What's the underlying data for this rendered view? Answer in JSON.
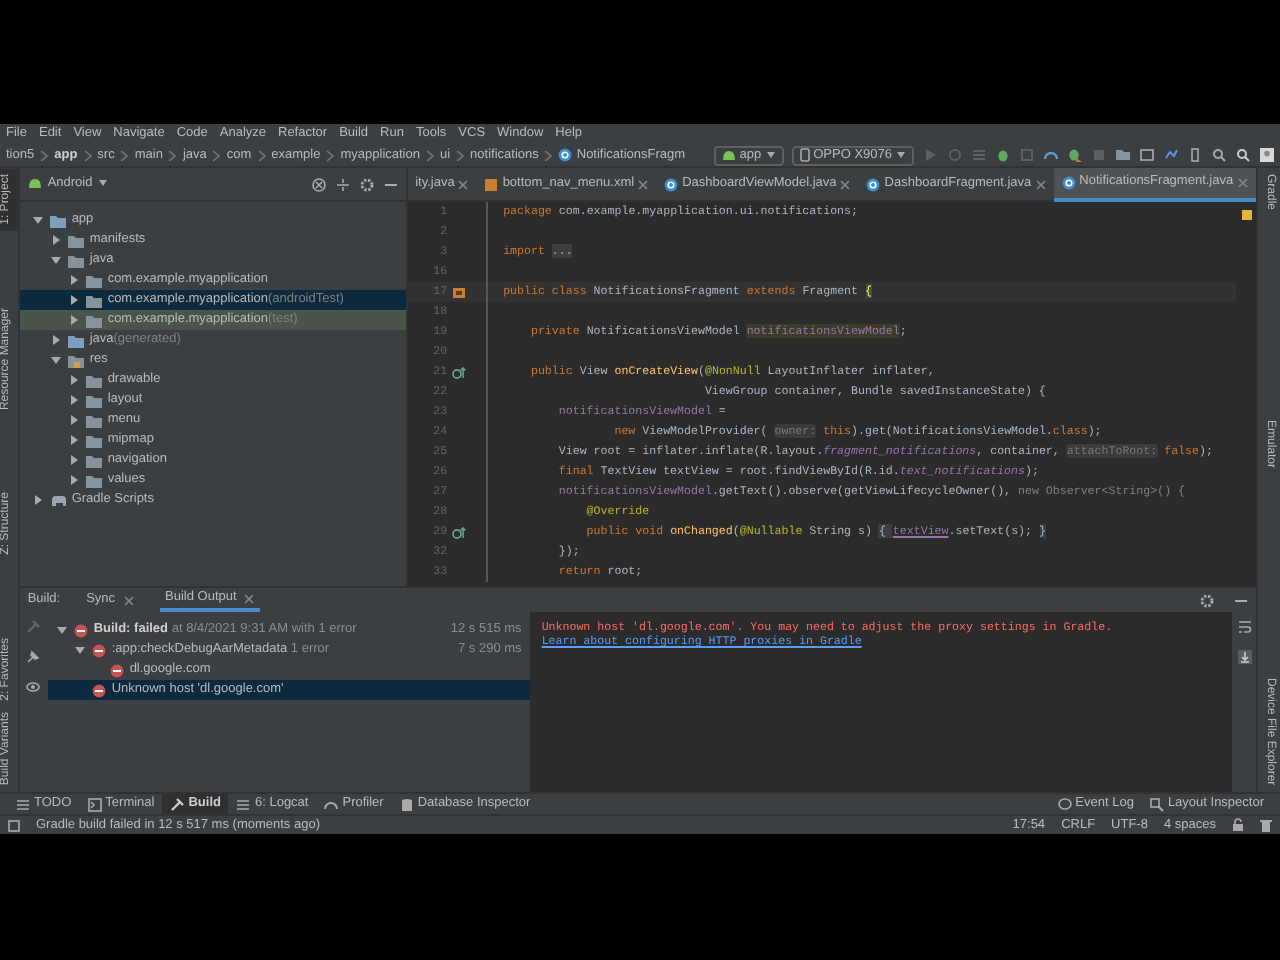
{
  "menu_bar": [
    "File",
    "Edit",
    "View",
    "Navigate",
    "Code",
    "Analyze",
    "Refactor",
    "Build",
    "Run",
    "Tools",
    "VCS",
    "Window",
    "Help"
  ],
  "breadcrumb": [
    "tion5",
    "app",
    "src",
    "main",
    "java",
    "com",
    "example",
    "myapplication",
    "ui",
    "notifications",
    "NotificationsFragm"
  ],
  "run_config": {
    "module": "app",
    "device": "OPPO X9076"
  },
  "left_strip": [
    {
      "label": "1: Project",
      "selected": true
    },
    {
      "label": "Resource Manager",
      "selected": false
    },
    {
      "label": "Z: Structure",
      "selected": false
    },
    {
      "label": "2: Favorites",
      "selected": false
    },
    {
      "label": "Build Variants",
      "selected": false
    }
  ],
  "project_panel": {
    "view": "Android",
    "tree": [
      {
        "label": "app",
        "kind": "module",
        "expanded": true,
        "selected": false,
        "children": [
          {
            "label": "manifests",
            "kind": "folder",
            "expanded": false,
            "selected": false
          },
          {
            "label": "java",
            "kind": "folder",
            "expanded": true,
            "selected": false,
            "children": [
              {
                "label": "com.example.myapplication",
                "kind": "package",
                "expanded": false,
                "selected": false
              },
              {
                "label": "com.example.myapplication",
                "suffix": "(androidTest)",
                "kind": "package-test",
                "expanded": false,
                "selected": true
              },
              {
                "label": "com.example.myapplication",
                "suffix": "(test)",
                "kind": "package-test",
                "expanded": false,
                "selected": false
              }
            ]
          },
          {
            "label": "java",
            "suffix": "(generated)",
            "kind": "generated",
            "expanded": false,
            "selected": false
          },
          {
            "label": "res",
            "kind": "res",
            "expanded": true,
            "selected": false,
            "children": [
              {
                "label": "drawable",
                "kind": "package",
                "expanded": false,
                "selected": false
              },
              {
                "label": "layout",
                "kind": "package",
                "expanded": false,
                "selected": false
              },
              {
                "label": "menu",
                "kind": "package",
                "expanded": false,
                "selected": false
              },
              {
                "label": "mipmap",
                "kind": "package",
                "expanded": false,
                "selected": false
              },
              {
                "label": "navigation",
                "kind": "package",
                "expanded": false,
                "selected": false
              },
              {
                "label": "values",
                "kind": "package",
                "expanded": false,
                "selected": false
              }
            ]
          }
        ]
      },
      {
        "label": "Gradle Scripts",
        "kind": "gradle",
        "expanded": false,
        "selected": false
      }
    ]
  },
  "editor_tabs": [
    {
      "label": "ity.java",
      "kind": "plain",
      "selected": false
    },
    {
      "label": "bottom_nav_menu.xml",
      "kind": "xml",
      "selected": false
    },
    {
      "label": "DashboardViewModel.java",
      "kind": "class",
      "selected": false
    },
    {
      "label": "DashboardFragment.java",
      "kind": "class",
      "selected": false
    },
    {
      "label": "NotificationsFragment.java",
      "kind": "class",
      "selected": true
    }
  ],
  "code_lines": [
    {
      "number": "1",
      "kind": "plain",
      "tokens": [
        {
          "kind": "kw",
          "text": "package "
        },
        {
          "kind": "text",
          "text": "com.example.myapplication.ui.notifications;"
        }
      ]
    },
    {
      "number": "2",
      "kind": "plain"
    },
    {
      "number": "3",
      "kind": "plain",
      "tokens": [
        {
          "kind": "kw",
          "text": "import "
        },
        {
          "kind": "fold",
          "text": "..."
        }
      ]
    },
    {
      "number": "16",
      "kind": "plain"
    },
    {
      "number": "17",
      "kind": "class-marker",
      "current": true,
      "tokens": [
        {
          "kind": "kw",
          "text": "public class "
        },
        {
          "kind": "text",
          "text": "NotificationsFragment "
        },
        {
          "kind": "kw",
          "text": "extends "
        },
        {
          "kind": "text",
          "text": "Fragment "
        },
        {
          "kind": "brace",
          "text": "{"
        }
      ]
    },
    {
      "number": "18",
      "kind": "plain"
    },
    {
      "number": "19",
      "kind": "plain",
      "tokens": [
        {
          "kind": "kw",
          "text": "    private "
        },
        {
          "kind": "text",
          "text": "NotificationsViewModel "
        },
        {
          "kind": "marked",
          "text": "notificationsViewModel"
        },
        {
          "kind": "text",
          "text": ";"
        }
      ]
    },
    {
      "number": "20",
      "kind": "plain"
    },
    {
      "number": "21",
      "kind": "override-marker",
      "tokens": [
        {
          "kind": "kw",
          "text": "    public "
        },
        {
          "kind": "text",
          "text": "View "
        },
        {
          "kind": "method",
          "text": "onCreateView"
        },
        {
          "kind": "text",
          "text": "("
        },
        {
          "kind": "annot",
          "text": "@NonNull"
        },
        {
          "kind": "text",
          "text": " LayoutInflater inflater,"
        }
      ]
    },
    {
      "number": "22",
      "kind": "plain",
      "tokens": [
        {
          "kind": "text",
          "text": "                             ViewGroup container, Bundle savedInstanceState) {"
        }
      ]
    },
    {
      "number": "23",
      "kind": "plain",
      "tokens": [
        {
          "kind": "field",
          "text": "        notificationsViewModel"
        },
        {
          "kind": "text",
          "text": " ="
        }
      ]
    },
    {
      "number": "24",
      "kind": "plain",
      "tokens": [
        {
          "kind": "kw",
          "text": "                new "
        },
        {
          "kind": "text",
          "text": "ViewModelProvider( "
        },
        {
          "kind": "hint",
          "text": "owner:"
        },
        {
          "kind": "kw",
          "text": " this"
        },
        {
          "kind": "text",
          "text": ").get(NotificationsViewModel."
        },
        {
          "kind": "kw",
          "text": "class"
        },
        {
          "kind": "text",
          "text": ");"
        }
      ]
    },
    {
      "number": "25",
      "kind": "plain",
      "tokens": [
        {
          "kind": "text",
          "text": "        View root = inflater.inflate(R.layout."
        },
        {
          "kind": "fielditalic",
          "text": "fragment_notifications"
        },
        {
          "kind": "text",
          "text": ", container, "
        },
        {
          "kind": "hint",
          "text": "attachToRoot:"
        },
        {
          "kind": "kw",
          "text": " false"
        },
        {
          "kind": "text",
          "text": ");"
        }
      ]
    },
    {
      "number": "26",
      "kind": "plain",
      "tokens": [
        {
          "kind": "kw",
          "text": "        final "
        },
        {
          "kind": "text",
          "text": "TextView textView = root.findViewById(R.id."
        },
        {
          "kind": "fielditalic",
          "text": "text_notifications"
        },
        {
          "kind": "text",
          "text": ");"
        }
      ]
    },
    {
      "number": "27",
      "kind": "plain",
      "tokens": [
        {
          "kind": "field",
          "text": "        notificationsViewModel"
        },
        {
          "kind": "text",
          "text": ".getText().observe(getViewLifecycleOwner(), "
        },
        {
          "kind": "dim",
          "text": "new Observer<String>() {"
        }
      ]
    },
    {
      "number": "28",
      "kind": "plain",
      "tokens": [
        {
          "kind": "annot",
          "text": "            @Override"
        }
      ]
    },
    {
      "number": "29",
      "kind": "override-marker",
      "tokens": [
        {
          "kind": "kw",
          "text": "            public void "
        },
        {
          "kind": "method",
          "text": "onChanged"
        },
        {
          "kind": "text",
          "text": "("
        },
        {
          "kind": "annot",
          "text": "@Nullable"
        },
        {
          "kind": "text",
          "text": " String s) "
        },
        {
          "kind": "fold",
          "text": "{ "
        },
        {
          "kind": "underline",
          "text": "textView"
        },
        {
          "kind": "text",
          "text": ".setText(s); "
        },
        {
          "kind": "fold",
          "text": "}"
        }
      ]
    },
    {
      "number": "32",
      "kind": "plain",
      "tokens": [
        {
          "kind": "text",
          "text": "        });"
        }
      ]
    },
    {
      "number": "33",
      "kind": "plain",
      "tokens": [
        {
          "kind": "kw",
          "text": "        return "
        },
        {
          "kind": "text",
          "text": "root;"
        }
      ]
    }
  ],
  "build_panel": {
    "title": "Build:",
    "tabs": [
      {
        "label": "Sync",
        "selected": false
      },
      {
        "label": "Build Output",
        "selected": true
      }
    ],
    "tree": [
      {
        "label": "Build:",
        "detail_bold": "failed",
        "detail": "at 8/4/2021 9:31 AM with 1 error",
        "time": "12 s 515 ms",
        "expanded": true,
        "selected": false,
        "children": [
          {
            "label": ":app:checkDebugAarMetadata",
            "detail": "1 error",
            "time": "7 s 290 ms",
            "expanded": true,
            "selected": false,
            "children": [
              {
                "label": "dl.google.com",
                "selected": false
              }
            ]
          },
          {
            "label": "Unknown host 'dl.google.com'",
            "selected": true
          }
        ]
      }
    ],
    "output": {
      "error": "Unknown host 'dl.google.com'. You may need to adjust the proxy settings in Gradle.",
      "link": "Learn about configuring HTTP proxies in Gradle"
    }
  },
  "tool_windows": [
    {
      "label": "TODO",
      "kind": "list",
      "selected": false
    },
    {
      "label": "Terminal",
      "kind": "terminal",
      "selected": false
    },
    {
      "label": "Build",
      "kind": "hammer",
      "selected": true
    },
    {
      "label": "6: Logcat",
      "kind": "list",
      "selected": false
    },
    {
      "label": "Profiler",
      "kind": "gauge",
      "selected": false
    },
    {
      "label": "Database Inspector",
      "kind": "database",
      "selected": false
    }
  ],
  "right_tool_windows": [
    "Event Log",
    "Layout Inspector"
  ],
  "right_strip": [
    "Gradle",
    "Emulator",
    "Device File Explorer"
  ],
  "status_bar": {
    "message": "Gradle build failed in 12 s 517 ms (moments ago)",
    "position": "17:54",
    "line_separator": "CRLF",
    "encoding": "UTF-8",
    "indent": "4 spaces"
  }
}
